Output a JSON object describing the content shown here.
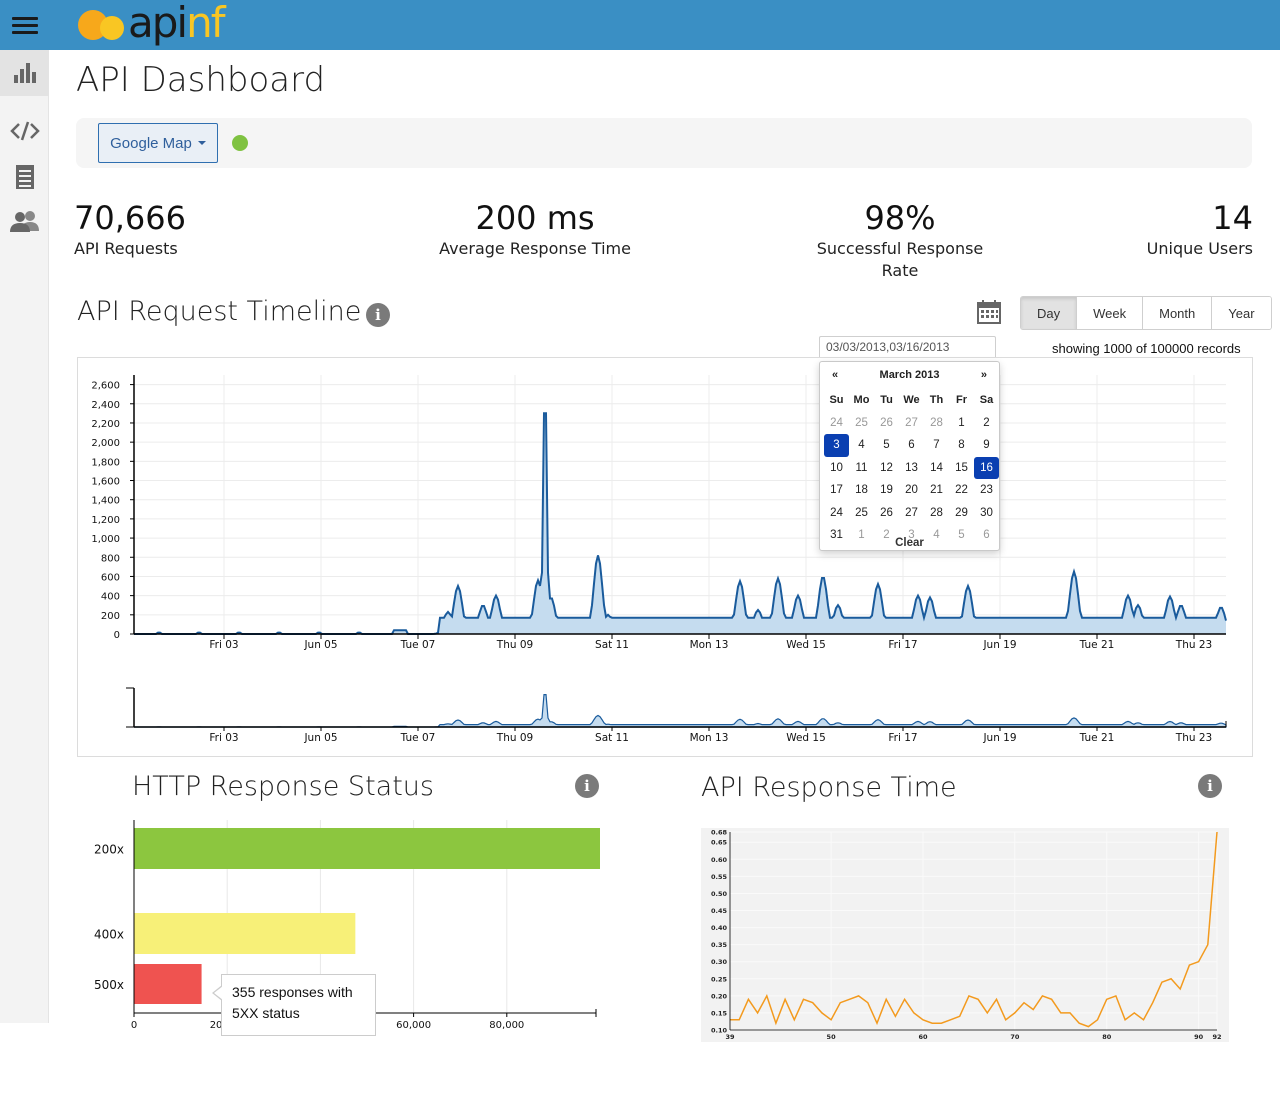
{
  "app": {
    "logo_text_a": "api",
    "logo_text_b": "nf",
    "page_title": "API Dashboard",
    "brand_color": "#3a8fc4"
  },
  "sidebar": {
    "items": [
      {
        "icon": "bar-chart-icon",
        "active": true
      },
      {
        "icon": "code-icon",
        "active": false
      },
      {
        "icon": "document-icon",
        "active": false
      },
      {
        "icon": "users-icon",
        "active": false
      }
    ]
  },
  "filter": {
    "map_button_label": "Google Map",
    "status_color": "#7fc241"
  },
  "stats": [
    {
      "value": "70,666",
      "label": "API Requests"
    },
    {
      "value": "200 ms",
      "label": "Average Response Time"
    },
    {
      "value": "98%",
      "label": "Successful Response Rate"
    },
    {
      "value": "14",
      "label": "Unique Users"
    }
  ],
  "timeline": {
    "title": "API Request Timeline",
    "info_icon_text": "i",
    "ranges": [
      "Day",
      "Week",
      "Month",
      "Year"
    ],
    "active_range": "Day",
    "date_input_value": "03/03/2013,03/16/2013",
    "records_text": "showing 1000 of 100000 records"
  },
  "datepicker": {
    "prev": "«",
    "next": "»",
    "month_label": "March 2013",
    "weekdays": [
      "Su",
      "Mo",
      "Tu",
      "We",
      "Th",
      "Fr",
      "Sa"
    ],
    "days": [
      [
        "24",
        "25",
        "26",
        "27",
        "28",
        "1",
        "2"
      ],
      [
        "3",
        "4",
        "5",
        "6",
        "7",
        "8",
        "9"
      ],
      [
        "10",
        "11",
        "12",
        "13",
        "14",
        "15",
        "16"
      ],
      [
        "17",
        "18",
        "19",
        "20",
        "21",
        "22",
        "23"
      ],
      [
        "24",
        "25",
        "26",
        "27",
        "28",
        "29",
        "30"
      ],
      [
        "31",
        "1",
        "2",
        "3",
        "4",
        "5",
        "6"
      ]
    ],
    "selected": [
      "3",
      "16"
    ],
    "clear_label": "Clear"
  },
  "http_status": {
    "title": "HTTP Response Status",
    "info_icon_text": "i",
    "tooltip_text": "355 responses with 5XX status"
  },
  "response_time": {
    "title": "API Response Time",
    "info_icon_text": "i"
  },
  "chart_data": [
    {
      "type": "area",
      "title": "",
      "x_ticks": [
        "Fri 03",
        "Jun 05",
        "Tue 07",
        "Thu 09",
        "Sat 11",
        "Mon 13",
        "Wed 15",
        "Fri 17",
        "Jun 19",
        "Tue 21",
        "Thu 23"
      ],
      "ylim": [
        0,
        2700
      ],
      "y_ticks": [
        "0",
        "200",
        "400",
        "600",
        "800",
        "1,000",
        "1,200",
        "1,400",
        "1,600",
        "1,800",
        "2,000",
        "2,200",
        "2,400",
        "2,600"
      ],
      "color": "#1a5b9c",
      "fill": "#c5dcef",
      "series": [
        {
          "values": [
            [
              0,
              0
            ],
            [
              2,
              20
            ],
            [
              4,
              10
            ],
            [
              6,
              0
            ],
            [
              8,
              15
            ],
            [
              10,
              0
            ],
            [
              12,
              5
            ],
            [
              14,
              25
            ],
            [
              16,
              10
            ],
            [
              18,
              0
            ],
            [
              20,
              0
            ],
            [
              22,
              10
            ],
            [
              24,
              0
            ],
            [
              26,
              5
            ],
            [
              28,
              0
            ],
            [
              30,
              0
            ],
            [
              32,
              0
            ],
            [
              34,
              10
            ],
            [
              36,
              0
            ],
            [
              38,
              5
            ],
            [
              40,
              0
            ],
            [
              42,
              15
            ],
            [
              44,
              0
            ],
            [
              46,
              5
            ],
            [
              48,
              0
            ],
            [
              50,
              0
            ],
            [
              52,
              20
            ],
            [
              54,
              0
            ],
            [
              56,
              0
            ],
            [
              58,
              0
            ],
            [
              60,
              0
            ],
            [
              62,
              0
            ],
            [
              64,
              0
            ],
            [
              66,
              0
            ],
            [
              68,
              0
            ],
            [
              70,
              0
            ],
            [
              72,
              0
            ],
            [
              74,
              0
            ],
            [
              76,
              0
            ],
            [
              78,
              0
            ],
            [
              80,
              0
            ],
            [
              82,
              0
            ],
            [
              84,
              10
            ],
            [
              86,
              0
            ],
            [
              88,
              0
            ],
            [
              90,
              0
            ],
            [
              92,
              0
            ],
            [
              94,
              0
            ],
            [
              96,
              0
            ],
            [
              98,
              0
            ],
            [
              100,
              0
            ],
            [
              102,
              0
            ],
            [
              104,
              0
            ],
            [
              106,
              0
            ],
            [
              108,
              0
            ],
            [
              110,
              0
            ],
            [
              112,
              0
            ],
            [
              114,
              0
            ],
            [
              116,
              0
            ],
            [
              118,
              0
            ],
            [
              120,
              0
            ],
            [
              122,
              0
            ],
            [
              124,
              0
            ],
            [
              126,
              0
            ],
            [
              128,
              0
            ],
            [
              130,
              0
            ],
            [
              132,
              0
            ],
            [
              134,
              0
            ],
            [
              136,
              0
            ],
            [
              138,
              0
            ],
            [
              140,
              0
            ],
            [
              142,
              0
            ],
            [
              144,
              0
            ],
            [
              146,
              0
            ],
            [
              148,
              0
            ],
            [
              150,
              0
            ],
            [
              152,
              0
            ],
            [
              154,
              0
            ],
            [
              156,
              0
            ],
            [
              158,
              0
            ],
            [
              160,
              0
            ],
            [
              162,
              0
            ],
            [
              164,
              0
            ],
            [
              166,
              0
            ],
            [
              168,
              0
            ],
            [
              170,
              0
            ],
            [
              172,
              0
            ],
            [
              174,
              0
            ],
            [
              176,
              0
            ],
            [
              178,
              0
            ],
            [
              180,
              0
            ],
            [
              182,
              0
            ],
            [
              184,
              0
            ],
            [
              186,
              0
            ],
            [
              188,
              0
            ],
            [
              190,
              0
            ],
            [
              192,
              0
            ],
            [
              194,
              0
            ],
            [
              196,
              0
            ],
            [
              198,
              0
            ],
            [
              200,
              0
            ],
            [
              202,
              0
            ],
            [
              204,
              0
            ],
            [
              206,
              0
            ],
            [
              208,
              0
            ],
            [
              210,
              0
            ],
            [
              212,
              0
            ],
            [
              214,
              0
            ],
            [
              216,
              0
            ],
            [
              218,
              0
            ],
            [
              220,
              0
            ],
            [
              222,
              0
            ],
            [
              224,
              0
            ],
            [
              226,
              0
            ],
            [
              228,
              0
            ],
            [
              230,
              0
            ],
            [
              232,
              0
            ],
            [
              234,
              0
            ],
            [
              236,
              0
            ],
            [
              238,
              0
            ],
            [
              240,
              0
            ],
            [
              242,
              0
            ],
            [
              244,
              0
            ],
            [
              246,
              0
            ],
            [
              248,
              0
            ],
            [
              250,
              0
            ],
            [
              252,
              0
            ],
            [
              254,
              0
            ],
            [
              256,
              0
            ],
            [
              258,
              0
            ],
            [
              260,
              0
            ],
            [
              262,
              0
            ],
            [
              264,
              0
            ],
            [
              266,
              0
            ],
            [
              268,
              0
            ],
            [
              270,
              0
            ],
            [
              272,
              0
            ],
            [
              274,
              0
            ],
            [
              276,
              0
            ],
            [
              278,
              0
            ],
            [
              280,
              0
            ],
            [
              282,
              0
            ],
            [
              284,
              0
            ],
            [
              286,
              0
            ],
            [
              288,
              0
            ],
            [
              290,
              0
            ],
            [
              292,
              0
            ],
            [
              294,
              0
            ],
            [
              296,
              0
            ],
            [
              298,
              0
            ],
            [
              300,
              0
            ],
            [
              302,
              0
            ],
            [
              304,
              0
            ],
            [
              306,
              0
            ],
            [
              308,
              0
            ],
            [
              310,
              0
            ],
            [
              312,
              0
            ],
            [
              314,
              0
            ],
            [
              316,
              0
            ],
            [
              318,
              0
            ],
            [
              320,
              0
            ],
            [
              322,
              0
            ],
            [
              324,
              0
            ],
            [
              326,
              0
            ],
            [
              328,
              0
            ],
            [
              330,
              0
            ],
            [
              332,
              0
            ],
            [
              334,
              0
            ],
            [
              336,
              0
            ],
            [
              338,
              0
            ],
            [
              340,
              0
            ],
            [
              342,
              0
            ],
            [
              344,
              0
            ],
            [
              346,
              0
            ],
            [
              348,
              0
            ],
            [
              350,
              0
            ],
            [
              352,
              0
            ],
            [
              354,
              0
            ],
            [
              356,
              0
            ],
            [
              358,
              0
            ],
            [
              360,
              0
            ],
            [
              362,
              0
            ],
            [
              364,
              0
            ],
            [
              366,
              0
            ],
            [
              368,
              0
            ],
            [
              370,
              0
            ],
            [
              372,
              0
            ],
            [
              374,
              0
            ],
            [
              376,
              0
            ],
            [
              378,
              0
            ],
            [
              380,
              0
            ],
            [
              382,
              0
            ],
            [
              384,
              0
            ],
            [
              386,
              0
            ],
            [
              388,
              0
            ],
            [
              390,
              0
            ],
            [
              392,
              0
            ],
            [
              394,
              0
            ],
            [
              396,
              0
            ],
            [
              398,
              0
            ],
            [
              400,
              0
            ]
          ]
        }
      ]
    },
    {
      "type": "bar",
      "title": "HTTP Response Status",
      "orientation": "horizontal",
      "categories": [
        "200x",
        "400x",
        "500x"
      ],
      "values": [
        100000,
        47500,
        14500
      ],
      "colors": [
        "#8cc63f",
        "#f7f078",
        "#ef5350"
      ],
      "x_ticks": [
        "0",
        "20,000",
        "40,000",
        "60,000",
        "80,000"
      ],
      "xlim": [
        0,
        100000
      ]
    },
    {
      "type": "line",
      "title": "API Response Time",
      "x_ticks": [
        "39",
        "50",
        "60",
        "70",
        "80",
        "90",
        "92"
      ],
      "y_ticks": [
        "0.10",
        "0.15",
        "0.20",
        "0.25",
        "0.30",
        "0.35",
        "0.40",
        "0.45",
        "0.50",
        "0.55",
        "0.60",
        "0.65",
        "0.68"
      ],
      "xlim": [
        39,
        92
      ],
      "ylim": [
        0.1,
        0.68
      ],
      "color": "#f39a1e",
      "x": [
        39,
        40,
        41,
        42,
        43,
        44,
        45,
        46,
        47,
        48,
        49,
        50,
        51,
        52,
        53,
        54,
        55,
        56,
        57,
        58,
        59,
        60,
        61,
        62,
        63,
        64,
        65,
        66,
        67,
        68,
        69,
        70,
        71,
        72,
        73,
        74,
        75,
        76,
        77,
        78,
        79,
        80,
        81,
        82,
        83,
        84,
        85,
        86,
        87,
        88,
        89,
        90,
        91,
        92
      ],
      "y": [
        0.13,
        0.13,
        0.19,
        0.15,
        0.2,
        0.12,
        0.19,
        0.13,
        0.19,
        0.18,
        0.15,
        0.13,
        0.18,
        0.19,
        0.2,
        0.18,
        0.12,
        0.19,
        0.14,
        0.19,
        0.15,
        0.13,
        0.12,
        0.12,
        0.13,
        0.14,
        0.2,
        0.19,
        0.15,
        0.19,
        0.13,
        0.15,
        0.18,
        0.16,
        0.2,
        0.19,
        0.15,
        0.15,
        0.12,
        0.11,
        0.13,
        0.19,
        0.2,
        0.13,
        0.15,
        0.13,
        0.18,
        0.24,
        0.25,
        0.22,
        0.29,
        0.3,
        0.35,
        0.68
      ]
    }
  ]
}
